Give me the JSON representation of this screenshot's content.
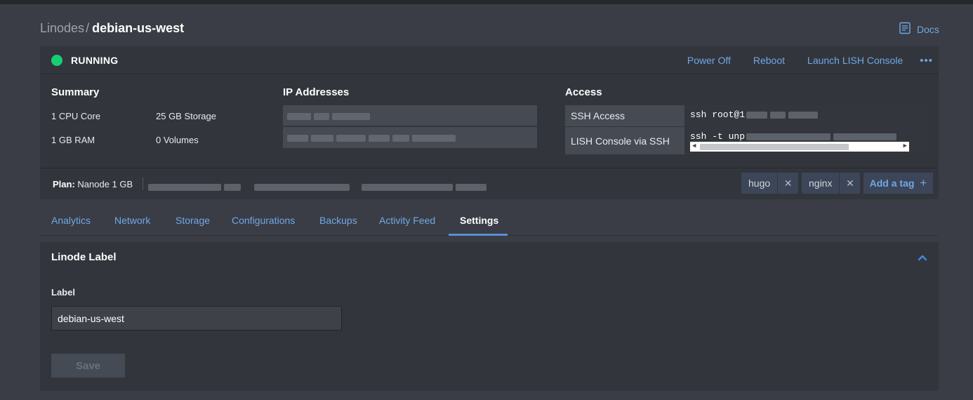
{
  "breadcrumb": {
    "parent": "Linodes",
    "separator": "/",
    "current": "debian-us-west"
  },
  "docs": {
    "label": "Docs",
    "icon": "document-icon"
  },
  "status": {
    "label": "RUNNING",
    "color": "#17cf73"
  },
  "actions": {
    "power_off": "Power Off",
    "reboot": "Reboot",
    "lish": "Launch LISH Console",
    "more": "•••"
  },
  "summary": {
    "title": "Summary",
    "cpu": "1 CPU Core",
    "storage": "25 GB Storage",
    "ram": "1 GB RAM",
    "volumes": "0 Volumes"
  },
  "ip": {
    "title": "IP Addresses"
  },
  "access": {
    "title": "Access",
    "ssh_label": "SSH Access",
    "ssh_value": "ssh root@1",
    "lish_label": "LISH Console via SSH",
    "lish_value": "ssh -t unp"
  },
  "plan": {
    "label": "Plan:",
    "value": "Nanode 1 GB"
  },
  "tags": [
    {
      "label": "hugo"
    },
    {
      "label": "nginx"
    }
  ],
  "add_tag": {
    "label": "Add a tag",
    "icon": "+"
  },
  "tabs": [
    {
      "label": "Analytics"
    },
    {
      "label": "Network"
    },
    {
      "label": "Storage"
    },
    {
      "label": "Configurations"
    },
    {
      "label": "Backups"
    },
    {
      "label": "Activity Feed"
    },
    {
      "label": "Settings",
      "active": true
    }
  ],
  "settings": {
    "panel_title": "Linode Label",
    "field_label": "Label",
    "field_value": "debian-us-west",
    "save_label": "Save"
  },
  "colors": {
    "accent": "#6fa8e6",
    "background": "#3a3d45",
    "card": "#32353c",
    "running": "#17cf73"
  }
}
